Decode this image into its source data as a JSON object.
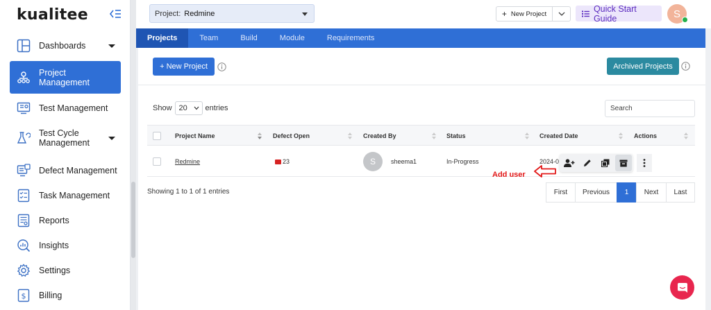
{
  "logo": {
    "text": "kualitee"
  },
  "sidebar": {
    "items": [
      {
        "label": "Dashboards"
      },
      {
        "label": "Project Management"
      },
      {
        "label": "Test Management"
      },
      {
        "label": "Test Cycle Management"
      },
      {
        "label": "Defect Management"
      },
      {
        "label": "Task Management"
      },
      {
        "label": "Reports"
      },
      {
        "label": "Insights"
      },
      {
        "label": "Settings"
      },
      {
        "label": "Billing"
      }
    ],
    "active_color": "#2f6fd6"
  },
  "header": {
    "project_prefix": "Project:",
    "project_value": "Redmine",
    "new_project_label": "New Project",
    "quick_start_label": "Quick Start Guide",
    "avatar_initial": "S"
  },
  "tabs": [
    {
      "label": "Projects"
    },
    {
      "label": "Team"
    },
    {
      "label": "Build"
    },
    {
      "label": "Module"
    },
    {
      "label": "Requirements"
    }
  ],
  "toolbar": {
    "new_project_label": "+ New Project",
    "archived_label": "Archived Projects"
  },
  "entries": {
    "show_label": "Show",
    "value": "20",
    "entries_label": "entries",
    "search_placeholder": "Search"
  },
  "table": {
    "columns": [
      "Project Name",
      "Defect Open",
      "Created By",
      "Status",
      "Created Date",
      "Actions"
    ],
    "rows": [
      {
        "project_name": "Redmine",
        "defect_open": "23",
        "creator_initial": "S",
        "created_by": "sheema1",
        "status": "In-Progress",
        "created_date": "2024-0"
      }
    ]
  },
  "annotation": {
    "text": "Add user"
  },
  "footer": {
    "showing": "Showing 1 to 1 of 1 entries",
    "pagination": [
      "First",
      "Previous",
      "1",
      "Next",
      "Last"
    ]
  },
  "colors": {
    "primary": "#2f6fd6",
    "archived": "#2b8aa0",
    "quick_start_bg": "#ece6fb",
    "quick_start_text": "#5b2bbf",
    "annotation": "#e21818",
    "chat": "#e8264e"
  }
}
